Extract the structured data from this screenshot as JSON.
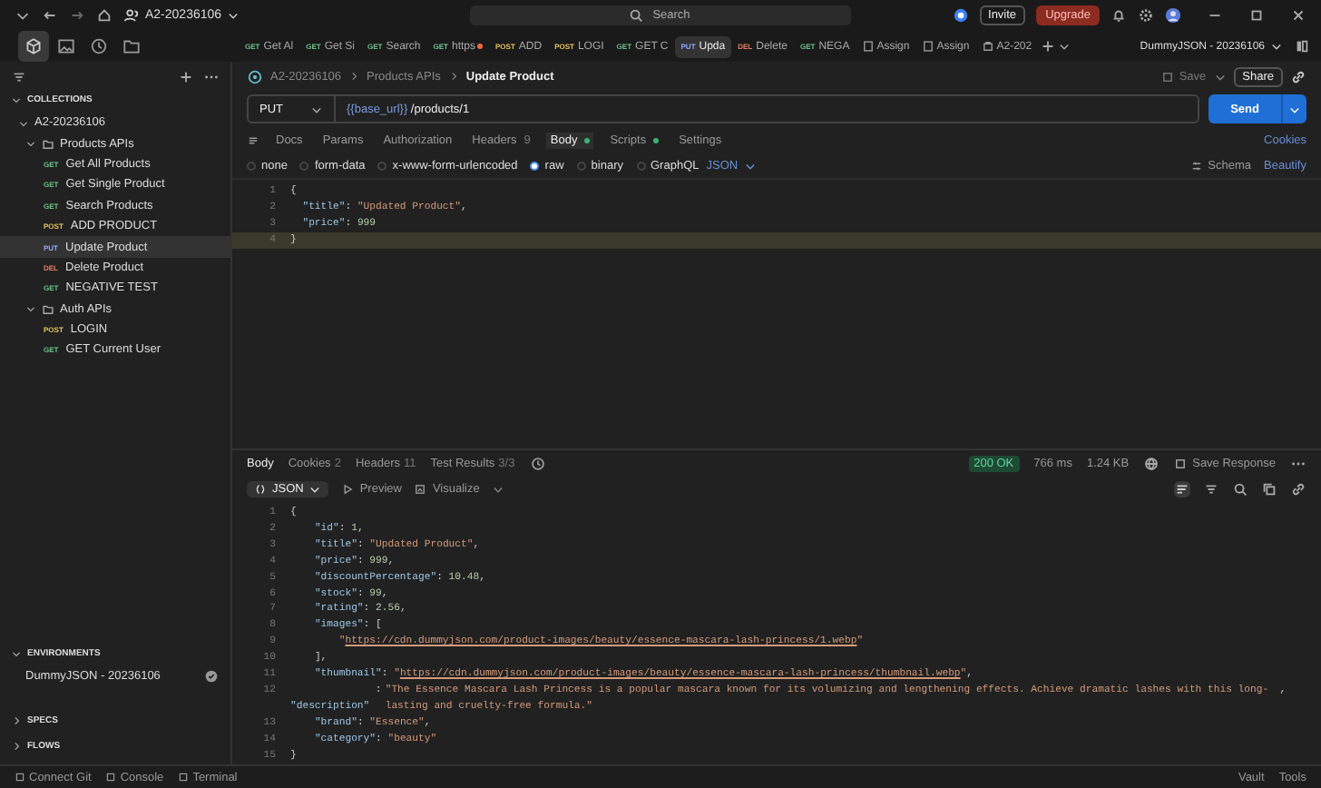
{
  "top_bar": {
    "workspace": "A2-20236106",
    "search": {
      "placeholder": "Search"
    },
    "invite": "Invite",
    "upgrade": "Upgrade"
  },
  "tab_bar": {
    "tabs": [
      {
        "kind": "request",
        "method": "GET",
        "color": "#6bbf8a",
        "label": "Get Al",
        "selected": false,
        "unsaved": false
      },
      {
        "kind": "request",
        "method": "GET",
        "color": "#6bbf8a",
        "label": "Get Si",
        "selected": false,
        "unsaved": false
      },
      {
        "kind": "request",
        "method": "GET",
        "color": "#6bbf8a",
        "label": "Search",
        "selected": false,
        "unsaved": false
      },
      {
        "kind": "request",
        "method": "GET",
        "color": "#6bbf8a",
        "label": "https",
        "selected": false,
        "unsaved": true
      },
      {
        "kind": "request",
        "method": "POST",
        "color": "#e5c35a",
        "label": "ADD",
        "selected": false,
        "unsaved": false
      },
      {
        "kind": "request",
        "method": "POST",
        "color": "#e5c35a",
        "label": "LOGI",
        "selected": false,
        "unsaved": false
      },
      {
        "kind": "request",
        "method": "GET",
        "color": "#6bbf8a",
        "label": "GET C",
        "selected": false,
        "unsaved": false
      },
      {
        "kind": "request",
        "method": "PUT",
        "color": "#8fa8ff",
        "label": "Upda",
        "selected": true,
        "unsaved": false
      },
      {
        "kind": "request",
        "method": "DEL",
        "color": "#e07b63",
        "label": "Delete",
        "selected": false,
        "unsaved": false
      },
      {
        "kind": "request",
        "method": "GET",
        "color": "#6bbf8a",
        "label": "NEGA",
        "selected": false,
        "unsaved": false
      },
      {
        "kind": "doc",
        "label": "Assign",
        "selected": false,
        "unsaved": false
      },
      {
        "kind": "doc",
        "label": "Assign",
        "selected": false,
        "unsaved": false
      },
      {
        "kind": "collection",
        "label": "A2-202",
        "selected": false,
        "unsaved": false
      }
    ],
    "environment": "DummyJSON - 20236106"
  },
  "sidebar": {
    "section": "COLLECTIONS",
    "collection": {
      "name": "A2-20236106",
      "expanded": true,
      "folders": [
        {
          "name": "Products APIs",
          "expanded": true,
          "requests": [
            {
              "method": "GET",
              "color": "#6bbf8a",
              "name": "Get All Products",
              "selected": false
            },
            {
              "method": "GET",
              "color": "#6bbf8a",
              "name": "Get Single Product",
              "selected": false
            },
            {
              "method": "GET",
              "color": "#6bbf8a",
              "name": "Search Products",
              "selected": false
            },
            {
              "method": "POST",
              "color": "#e5c35a",
              "name": "ADD PRODUCT",
              "selected": false
            },
            {
              "method": "PUT",
              "color": "#8fa8ff",
              "name": "Update Product",
              "selected": true
            },
            {
              "method": "DEL",
              "color": "#e07b63",
              "name": "Delete Product",
              "selected": false
            },
            {
              "method": "GET",
              "color": "#6bbf8a",
              "name": "NEGATIVE TEST",
              "selected": false
            }
          ]
        },
        {
          "name": "Auth APIs",
          "expanded": true,
          "requests": [
            {
              "method": "POST",
              "color": "#e5c35a",
              "name": "LOGIN",
              "selected": false
            },
            {
              "method": "GET",
              "color": "#6bbf8a",
              "name": "GET Current User",
              "selected": false
            }
          ]
        }
      ]
    },
    "environments": {
      "title": "ENVIRONMENTS",
      "items": [
        {
          "name": "DummyJSON - 20236106",
          "active": true
        }
      ]
    },
    "collapsed_sections": [
      "SPECS",
      "FLOWS"
    ]
  },
  "request": {
    "breadcrumb": [
      "A2-20236106",
      "Products APIs",
      "Update Product"
    ],
    "save": "Save",
    "share": "Share",
    "method": "PUT",
    "url_variable": "{{base_url}}",
    "url_path": "/products/1",
    "send": "Send",
    "tabs": [
      {
        "label": "Docs",
        "dot": false,
        "selected": false
      },
      {
        "label": "Params",
        "dot": false,
        "selected": false
      },
      {
        "label": "Authorization",
        "dot": false,
        "selected": false
      },
      {
        "label": "Headers",
        "count": "9",
        "dot": false,
        "selected": false
      },
      {
        "label": "Body",
        "dot": true,
        "selected": true
      },
      {
        "label": "Scripts",
        "dot": true,
        "selected": false
      },
      {
        "label": "Settings",
        "dot": false,
        "selected": false
      }
    ],
    "cookies": "Cookies",
    "body_types": [
      {
        "label": "none",
        "selected": false
      },
      {
        "label": "form-data",
        "selected": false
      },
      {
        "label": "x-www-form-urlencoded",
        "selected": false
      },
      {
        "label": "raw",
        "selected": true
      },
      {
        "label": "binary",
        "selected": false
      },
      {
        "label": "GraphQL",
        "selected": false
      }
    ],
    "format": "JSON",
    "schema": "Schema",
    "beautify": "Beautify",
    "code": [
      {
        "n": "1",
        "toks": [
          {
            "kind": "p",
            "text": "{"
          }
        ]
      },
      {
        "n": "2",
        "toks": [
          {
            "kind": "k",
            "text": "  \"title\""
          },
          {
            "kind": "p",
            "text": ": "
          },
          {
            "kind": "s",
            "text": "\"Updated Product\""
          },
          {
            "kind": "p",
            "text": ","
          }
        ]
      },
      {
        "n": "3",
        "toks": [
          {
            "kind": "k",
            "text": "  \"price\""
          },
          {
            "kind": "p",
            "text": ": "
          },
          {
            "kind": "n",
            "text": "999"
          }
        ]
      },
      {
        "n": "4",
        "toks": [
          {
            "kind": "p",
            "text": "}"
          }
        ]
      }
    ]
  },
  "response": {
    "tabs": [
      {
        "label": "Body",
        "selected": true
      },
      {
        "label": "Cookies",
        "count": "2",
        "selected": false
      },
      {
        "label": "Headers",
        "count": "11",
        "selected": false
      },
      {
        "label": "Test Results",
        "count": "3/3",
        "selected": false
      }
    ],
    "status": "200 OK",
    "time": "766 ms",
    "size": "1.24 KB",
    "save_response": "Save Response",
    "view": "JSON",
    "preview": "Preview",
    "visualize": "Visualize",
    "code": [
      {
        "n": "1",
        "toks": [
          {
            "kind": "p",
            "text": "{"
          }
        ]
      },
      {
        "n": "2",
        "toks": [
          {
            "kind": "k",
            "text": "    \"id\""
          },
          {
            "kind": "p",
            "text": ": "
          },
          {
            "kind": "n",
            "text": "1"
          },
          {
            "kind": "p",
            "text": ","
          }
        ]
      },
      {
        "n": "3",
        "toks": [
          {
            "kind": "k",
            "text": "    \"title\""
          },
          {
            "kind": "p",
            "text": ": "
          },
          {
            "kind": "s",
            "text": "\"Updated Product\""
          },
          {
            "kind": "p",
            "text": ","
          }
        ]
      },
      {
        "n": "4",
        "toks": [
          {
            "kind": "k",
            "text": "    \"price\""
          },
          {
            "kind": "p",
            "text": ": "
          },
          {
            "kind": "n",
            "text": "999"
          },
          {
            "kind": "p",
            "text": ","
          }
        ]
      },
      {
        "n": "5",
        "toks": [
          {
            "kind": "k",
            "text": "    \"discountPercentage\""
          },
          {
            "kind": "p",
            "text": ": "
          },
          {
            "kind": "n",
            "text": "10.48"
          },
          {
            "kind": "p",
            "text": ","
          }
        ]
      },
      {
        "n": "6",
        "toks": [
          {
            "kind": "k",
            "text": "    \"stock\""
          },
          {
            "kind": "p",
            "text": ": "
          },
          {
            "kind": "n",
            "text": "99"
          },
          {
            "kind": "p",
            "text": ","
          }
        ]
      },
      {
        "n": "7",
        "toks": [
          {
            "kind": "k",
            "text": "    \"rating\""
          },
          {
            "kind": "p",
            "text": ": "
          },
          {
            "kind": "n",
            "text": "2.56"
          },
          {
            "kind": "p",
            "text": ","
          }
        ]
      },
      {
        "n": "8",
        "toks": [
          {
            "kind": "k",
            "text": "    \"images\""
          },
          {
            "kind": "p",
            "text": ": ["
          }
        ]
      },
      {
        "n": "9",
        "toks": [
          {
            "kind": "s",
            "text": "        \""
          },
          {
            "kind": "l",
            "text": "https://cdn.dummyjson.com/product-images/beauty/essence-mascara-lash-princess/1.webp"
          },
          {
            "kind": "s",
            "text": "\""
          }
        ]
      },
      {
        "n": "10",
        "toks": [
          {
            "kind": "p",
            "text": "    ],"
          }
        ]
      },
      {
        "n": "11",
        "toks": [
          {
            "kind": "k",
            "text": "    \"thumbnail\""
          },
          {
            "kind": "p",
            "text": ": "
          },
          {
            "kind": "s",
            "text": "\""
          },
          {
            "kind": "l",
            "text": "https://cdn.dummyjson.com/product-images/beauty/essence-mascara-lash-princess/thumbnail.webp"
          },
          {
            "kind": "s",
            "text": "\""
          },
          {
            "kind": "p",
            "text": ","
          }
        ]
      },
      {
        "n": "12",
        "toks": [
          {
            "kind": "k",
            "text": "    \"description\""
          },
          {
            "kind": "p",
            "text": ": "
          },
          {
            "kind": "s",
            "text": "\"The Essence Mascara Lash Princess is a popular mascara known for its volumizing and lengthening effects. Achieve dramatic lashes with this long-lasting and cruelty-free formula.\""
          },
          {
            "kind": "p",
            "text": ","
          }
        ]
      },
      {
        "n": "13",
        "toks": [
          {
            "kind": "k",
            "text": "    \"brand\""
          },
          {
            "kind": "p",
            "text": ": "
          },
          {
            "kind": "s",
            "text": "\"Essence\""
          },
          {
            "kind": "p",
            "text": ","
          }
        ]
      },
      {
        "n": "14",
        "toks": [
          {
            "kind": "k",
            "text": "    \"category\""
          },
          {
            "kind": "p",
            "text": ": "
          },
          {
            "kind": "s",
            "text": "\"beauty\""
          }
        ]
      },
      {
        "n": "15",
        "toks": [
          {
            "kind": "p",
            "text": "}"
          }
        ]
      }
    ]
  },
  "status_bar": {
    "left": [
      "Connect Git",
      "Console",
      "Terminal"
    ],
    "right": [
      "Vault",
      "Tools"
    ]
  }
}
